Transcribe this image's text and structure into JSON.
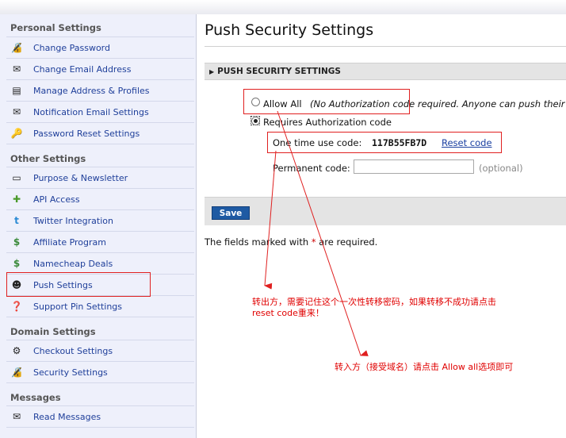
{
  "sidebar": {
    "sections": [
      {
        "title": "Personal Settings"
      },
      {
        "title": "Other Settings"
      },
      {
        "title": "Domain Settings"
      },
      {
        "title": "Messages"
      }
    ],
    "items": [
      {
        "label": "Change Password",
        "icon": "lock-icon"
      },
      {
        "label": "Change Email Address",
        "icon": "envelope-icon"
      },
      {
        "label": "Manage Address & Profiles",
        "icon": "address-card-icon"
      },
      {
        "label": "Notification Email Settings",
        "icon": "envelope-icon"
      },
      {
        "label": "Password Reset Settings",
        "icon": "key-icon"
      },
      {
        "label": "Purpose & Newsletter",
        "icon": "window-icon"
      },
      {
        "label": "API Access",
        "icon": "puzzle-icon"
      },
      {
        "label": "Twitter Integration",
        "icon": "twitter-icon"
      },
      {
        "label": "Affiliate Program",
        "icon": "dollar-icon"
      },
      {
        "label": "Namecheap Deals",
        "icon": "dollar-icon"
      },
      {
        "label": "Push Settings",
        "icon": "push-user-icon"
      },
      {
        "label": "Support Pin Settings",
        "icon": "help-icon"
      },
      {
        "label": "Checkout Settings",
        "icon": "gear-icon"
      },
      {
        "label": "Security Settings",
        "icon": "lock-icon"
      },
      {
        "label": "Read Messages",
        "icon": "envelope-icon"
      }
    ]
  },
  "main": {
    "title": "Push Security Settings",
    "section_header": "PUSH SECURITY SETTINGS",
    "allow_all_label": "Allow All",
    "allow_all_note": "(No Authorization code required. Anyone can push their",
    "requires_label": "Requires Authorization code",
    "one_time_label": "One time use code:",
    "one_time_value": "117B55FB7D",
    "reset_link": "Reset code",
    "permanent_label": "Permanent code:",
    "permanent_value": "",
    "optional_label": "(optional)",
    "save_label": "Save",
    "required_note_before": "The fields marked with ",
    "required_star": "*",
    "required_note_after": " are required."
  },
  "annotations": {
    "note1_line1": "转出方，需要记住这个一次性转移密码，如果转移不成功请点击",
    "note1_line2": "reset code重来！",
    "note2": "转入方（接受域名）请点击 Allow all选项即可"
  },
  "colors": {
    "link": "#1f3f9a",
    "annotation": "#e00000",
    "save_button": "#1e5aa3"
  }
}
